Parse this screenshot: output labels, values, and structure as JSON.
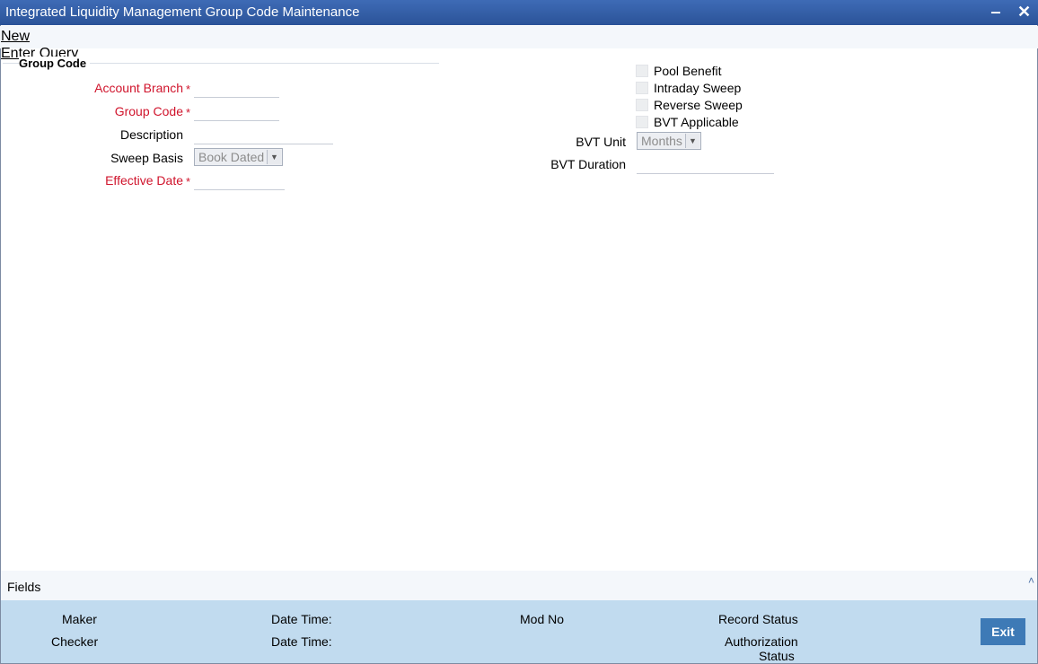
{
  "window": {
    "title": "Integrated Liquidity Management Group Code Maintenance",
    "minimize": "‒",
    "close": "✕"
  },
  "menu": {
    "new": "New",
    "enter_query": "Enter Query"
  },
  "section": {
    "legend": "Group Code"
  },
  "form": {
    "account_branch": {
      "label": "Account Branch",
      "value": ""
    },
    "group_code": {
      "label": "Group Code",
      "value": ""
    },
    "description": {
      "label": "Description",
      "value": ""
    },
    "sweep_basis": {
      "label": "Sweep Basis",
      "selected": "Book Dated"
    },
    "effective_date": {
      "label": "Effective Date",
      "value": ""
    },
    "required_mark": "*"
  },
  "options": {
    "pool_benefit": {
      "label": "Pool Benefit",
      "checked": false
    },
    "intraday_sweep": {
      "label": "Intraday Sweep",
      "checked": false
    },
    "reverse_sweep": {
      "label": "Reverse Sweep",
      "checked": false
    },
    "bvt_applicable": {
      "label": "BVT Applicable",
      "checked": false
    },
    "bvt_unit": {
      "label": "BVT Unit",
      "selected": "Months"
    },
    "bvt_duration": {
      "label": "BVT Duration",
      "value": ""
    }
  },
  "fields_bar": {
    "label": "Fields",
    "caret": "˄"
  },
  "footer": {
    "maker": "Maker",
    "checker": "Checker",
    "date_time_1": "Date Time:",
    "date_time_2": "Date Time:",
    "mod_no": "Mod No",
    "record_status": "Record Status",
    "authorization": "Authorization",
    "status": "Status",
    "exit": "Exit"
  },
  "colors": {
    "titlebar": "#2b5398",
    "required": "#d0142c",
    "footer": "#c1dbef",
    "exit_button": "#3e7ab6"
  }
}
